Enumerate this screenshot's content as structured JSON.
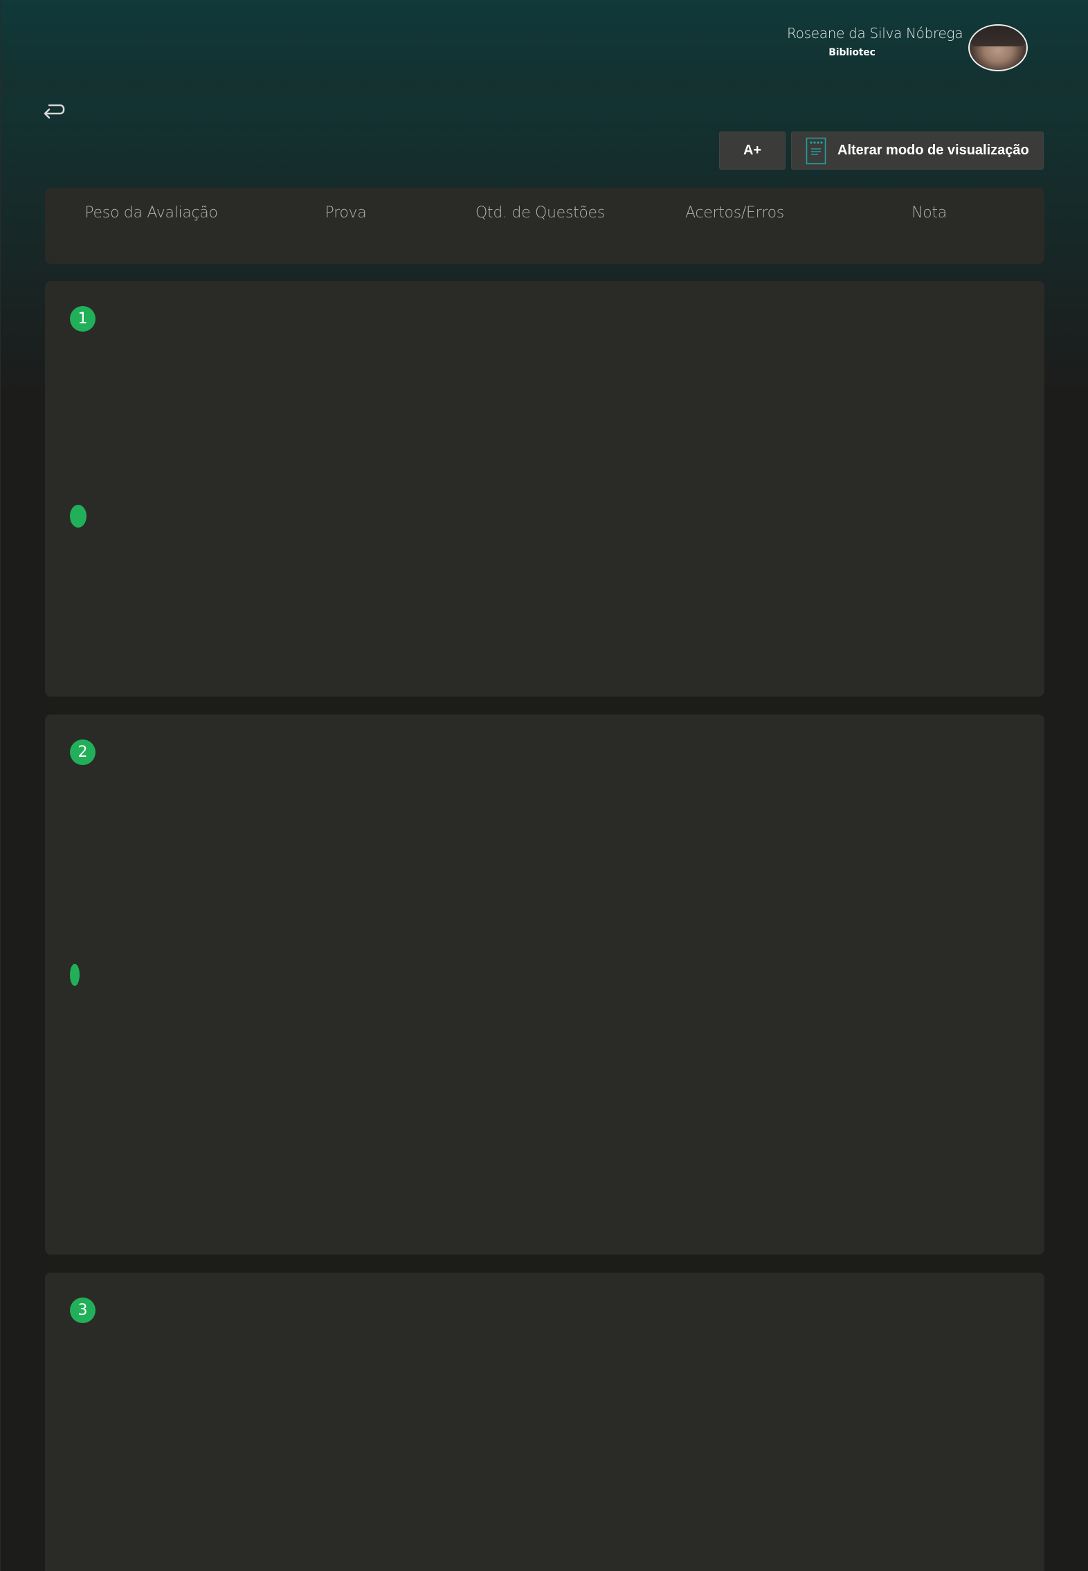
{
  "header": {
    "user_name": "Roseane da Silva Nóbrega",
    "user_org": "Bibliotec"
  },
  "toolbar": {
    "font_size_label": "A+",
    "view_mode_label": "Alterar modo de visualização"
  },
  "table_header": {
    "columns": [
      "Peso da Avaliação",
      "Prova",
      "Qtd. de Questões",
      "Acertos/Erros",
      "Nota"
    ]
  },
  "cards": [
    {
      "number": "1"
    },
    {
      "number": "2"
    },
    {
      "number": "3"
    }
  ],
  "colors": {
    "accent_green": "#21b059",
    "header_teal": "#10393a",
    "card_bg": "#2a2a27",
    "page_bg": "#1c1c1b"
  },
  "icons": [
    "back-arrow-icon",
    "document-view-icon",
    "avatar"
  ]
}
